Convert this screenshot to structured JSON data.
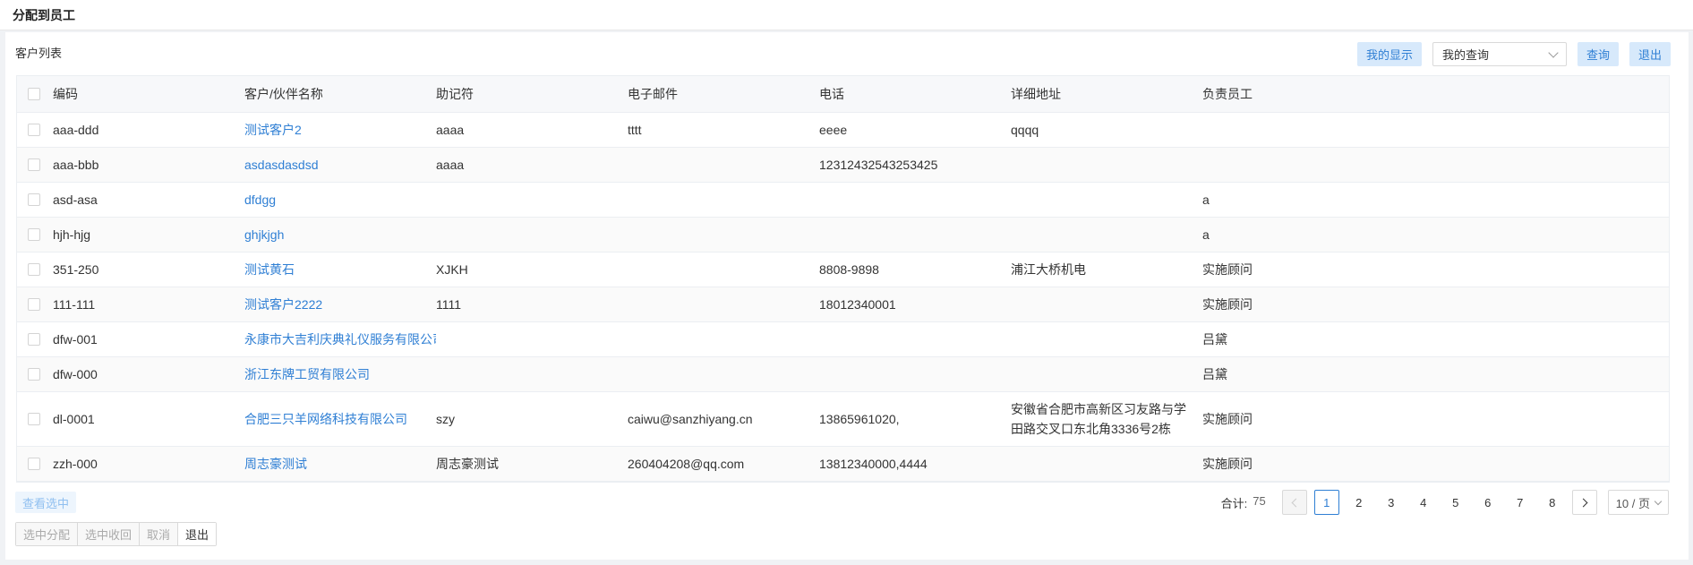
{
  "header": {
    "title": "分配到员工"
  },
  "panel": {
    "title": "客户列表"
  },
  "toolbar": {
    "my_display": "我的显示",
    "query_select": "我的查询",
    "query_button": "查询",
    "exit_button": "退出"
  },
  "table": {
    "columns": [
      "编码",
      "客户/伙伴名称",
      "助记符",
      "电子邮件",
      "电话",
      "详细地址",
      "负责员工"
    ],
    "rows": [
      {
        "code": "aaa-ddd",
        "name": "测试客户2",
        "mnemonic": "aaaa",
        "email": "tttt",
        "phone": "eeee",
        "address": "qqqq",
        "staff": ""
      },
      {
        "code": "aaa-bbb",
        "name": "asdasdasdsd",
        "mnemonic": "aaaa",
        "email": "",
        "phone": "12312432543253425",
        "address": "",
        "staff": ""
      },
      {
        "code": "asd-asa",
        "name": "dfdgg",
        "mnemonic": "",
        "email": "",
        "phone": "",
        "address": "",
        "staff": "a"
      },
      {
        "code": "hjh-hjg",
        "name": "ghjkjgh",
        "mnemonic": "",
        "email": "",
        "phone": "",
        "address": "",
        "staff": "a"
      },
      {
        "code": "351-250",
        "name": "测试黄石",
        "mnemonic": "XJKH",
        "email": "",
        "phone": "8808-9898",
        "address": "浦江大桥机电",
        "staff": "实施顾问"
      },
      {
        "code": "111-111",
        "name": "测试客户2222",
        "mnemonic": "1111",
        "email": "",
        "phone": "18012340001",
        "address": "",
        "staff": "实施顾问"
      },
      {
        "code": "dfw-001",
        "name": "永康市大吉利庆典礼仪服务有限公司",
        "mnemonic": "",
        "email": "",
        "phone": "",
        "address": "",
        "staff": "吕黛"
      },
      {
        "code": "dfw-000",
        "name": "浙江东牌工贸有限公司",
        "mnemonic": "",
        "email": "",
        "phone": "",
        "address": "",
        "staff": "吕黛"
      },
      {
        "code": "dl-0001",
        "name": "合肥三只羊网络科技有限公司",
        "mnemonic": "szy",
        "email": "caiwu@sanzhiyang.cn",
        "phone": "13865961020,",
        "address": "安徽省合肥市高新区习友路与学田路交叉口东北角3336号2栋",
        "staff": "实施顾问"
      },
      {
        "code": "zzh-000",
        "name": "周志豪测试",
        "mnemonic": "周志豪测试",
        "email": "260404208@qq.com",
        "phone": "13812340000,4444",
        "address": "",
        "staff": "实施顾问"
      }
    ]
  },
  "footer": {
    "view_selected": "查看选中",
    "actions": [
      "选中分配",
      "选中收回",
      "取消",
      "退出"
    ]
  },
  "pagination": {
    "total_label": "合计:",
    "total": "75",
    "pages": [
      "1",
      "2",
      "3",
      "4",
      "5",
      "6",
      "7",
      "8"
    ],
    "current_page": "1",
    "page_size": "10 / 页"
  },
  "colors": {
    "accent": "#2f7fd4",
    "light_button_bg": "#d7e9fb"
  }
}
